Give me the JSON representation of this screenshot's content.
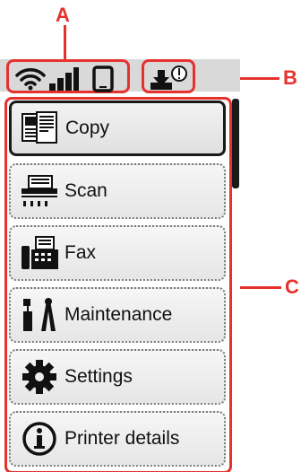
{
  "callouts": {
    "a": "A",
    "b": "B",
    "c": "C"
  },
  "status_bar": {
    "icons": [
      "wifi-icon",
      "signal-bars-icon",
      "phone-icon",
      "download-warning-icon"
    ]
  },
  "menu": {
    "items": [
      {
        "label": "Copy",
        "icon": "copy-icon",
        "selected": true
      },
      {
        "label": "Scan",
        "icon": "scan-icon",
        "selected": false
      },
      {
        "label": "Fax",
        "icon": "fax-icon",
        "selected": false
      },
      {
        "label": "Maintenance",
        "icon": "maintenance-icon",
        "selected": false
      },
      {
        "label": "Settings",
        "icon": "settings-gear-icon",
        "selected": false
      },
      {
        "label": "Printer details",
        "icon": "info-icon",
        "selected": false
      }
    ]
  },
  "colors": {
    "callout": "#e5322d",
    "status_bar": "#d9d9d9",
    "scrollbar": "#1a1a1a"
  }
}
